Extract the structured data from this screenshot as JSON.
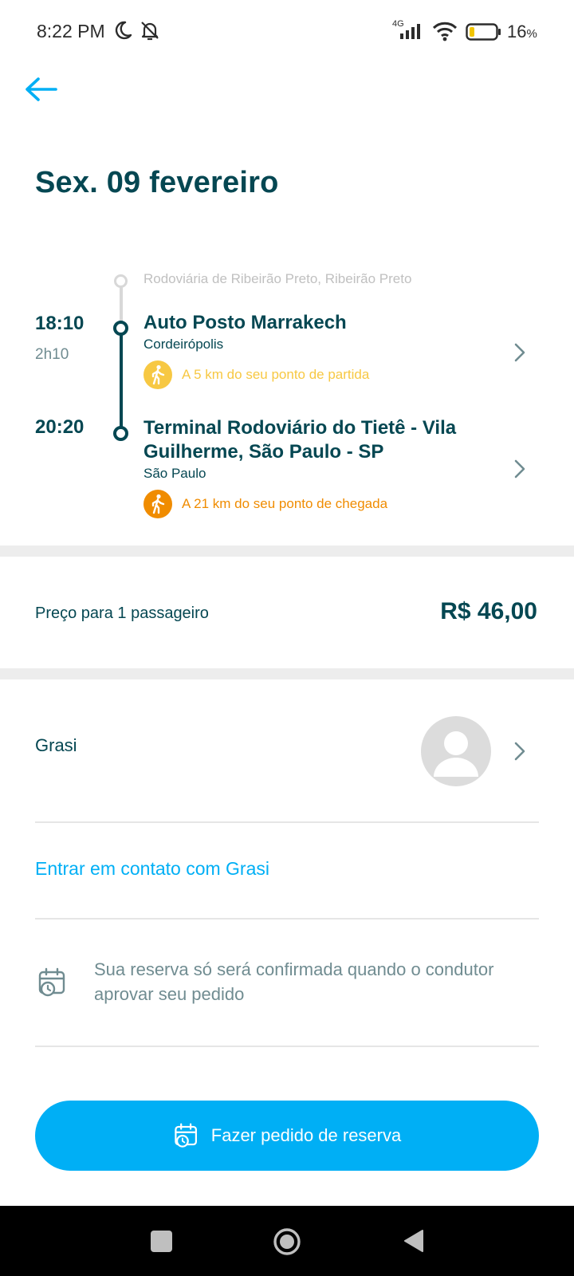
{
  "status_bar": {
    "time": "8:22 PM",
    "network": "4G",
    "battery_percent": "16",
    "battery_unit": "%"
  },
  "header": {
    "back_icon": "arrow-left-icon",
    "title": "Sex. 09 fevereiro"
  },
  "itinerary": {
    "origin_label": "Rodoviária de Ribeirão Preto, Ribeirão Preto",
    "departure": {
      "time": "18:10",
      "duration": "2h10",
      "name": "Auto Posto Marrakech",
      "city": "Cordeirópolis",
      "walk_text": "A 5 km do seu ponto de partida",
      "walk_color": "#f7c843"
    },
    "arrival": {
      "time": "20:20",
      "name_line1": "Terminal Rodoviário do Tietê - Vila",
      "name_line2": "Guilherme, São Paulo - SP",
      "city": "São Paulo",
      "walk_text": "A 21 km do seu ponto de chegada",
      "walk_color": "#f08c00"
    }
  },
  "price": {
    "label": "Preço para 1 passageiro",
    "value": "R$ 46,00"
  },
  "driver": {
    "name": "Grasi",
    "avatar_icon": "user-avatar-icon"
  },
  "contact": {
    "label": "Entrar em contato com Grasi"
  },
  "note": {
    "text": "Sua reserva só será confirmada quando o condutor aprovar seu pedido",
    "icon": "calendar-clock-icon"
  },
  "book_button": {
    "label": "Fazer pedido de reserva",
    "icon": "calendar-clock-icon"
  },
  "colors": {
    "primary_text": "#054752",
    "accent": "#00aff5",
    "muted": "#708c91"
  }
}
